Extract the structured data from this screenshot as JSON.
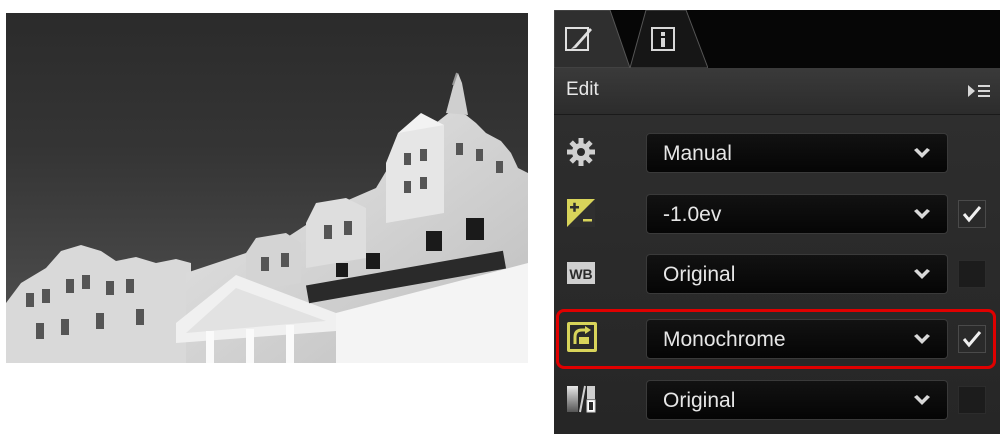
{
  "panel": {
    "tabs": [
      {
        "name": "edit-tab",
        "icon": "brush-edit-icon",
        "active": true
      },
      {
        "name": "info-tab",
        "icon": "info-icon",
        "active": false
      }
    ],
    "header": {
      "title": "Edit",
      "menu_icon": "panel-menu-icon"
    },
    "rows": [
      {
        "icon": "gear-icon",
        "value": "Manual",
        "has_checkbox": false,
        "checked": false
      },
      {
        "icon": "exposure-compensation-icon",
        "value": "-1.0ev",
        "has_checkbox": true,
        "checked": true
      },
      {
        "icon": "white-balance-icon",
        "icon_text": "WB",
        "value": "Original",
        "has_checkbox": true,
        "checked": false
      },
      {
        "icon": "picture-control-icon",
        "value": "Monochrome",
        "has_checkbox": true,
        "checked": true,
        "highlighted": true
      },
      {
        "icon": "active-d-lighting-icon",
        "value": "Original",
        "has_checkbox": true,
        "checked": false
      }
    ]
  },
  "colors": {
    "highlight": "#e00000",
    "panel_bg": "#262626",
    "accent_icon": "#d8d45a"
  }
}
